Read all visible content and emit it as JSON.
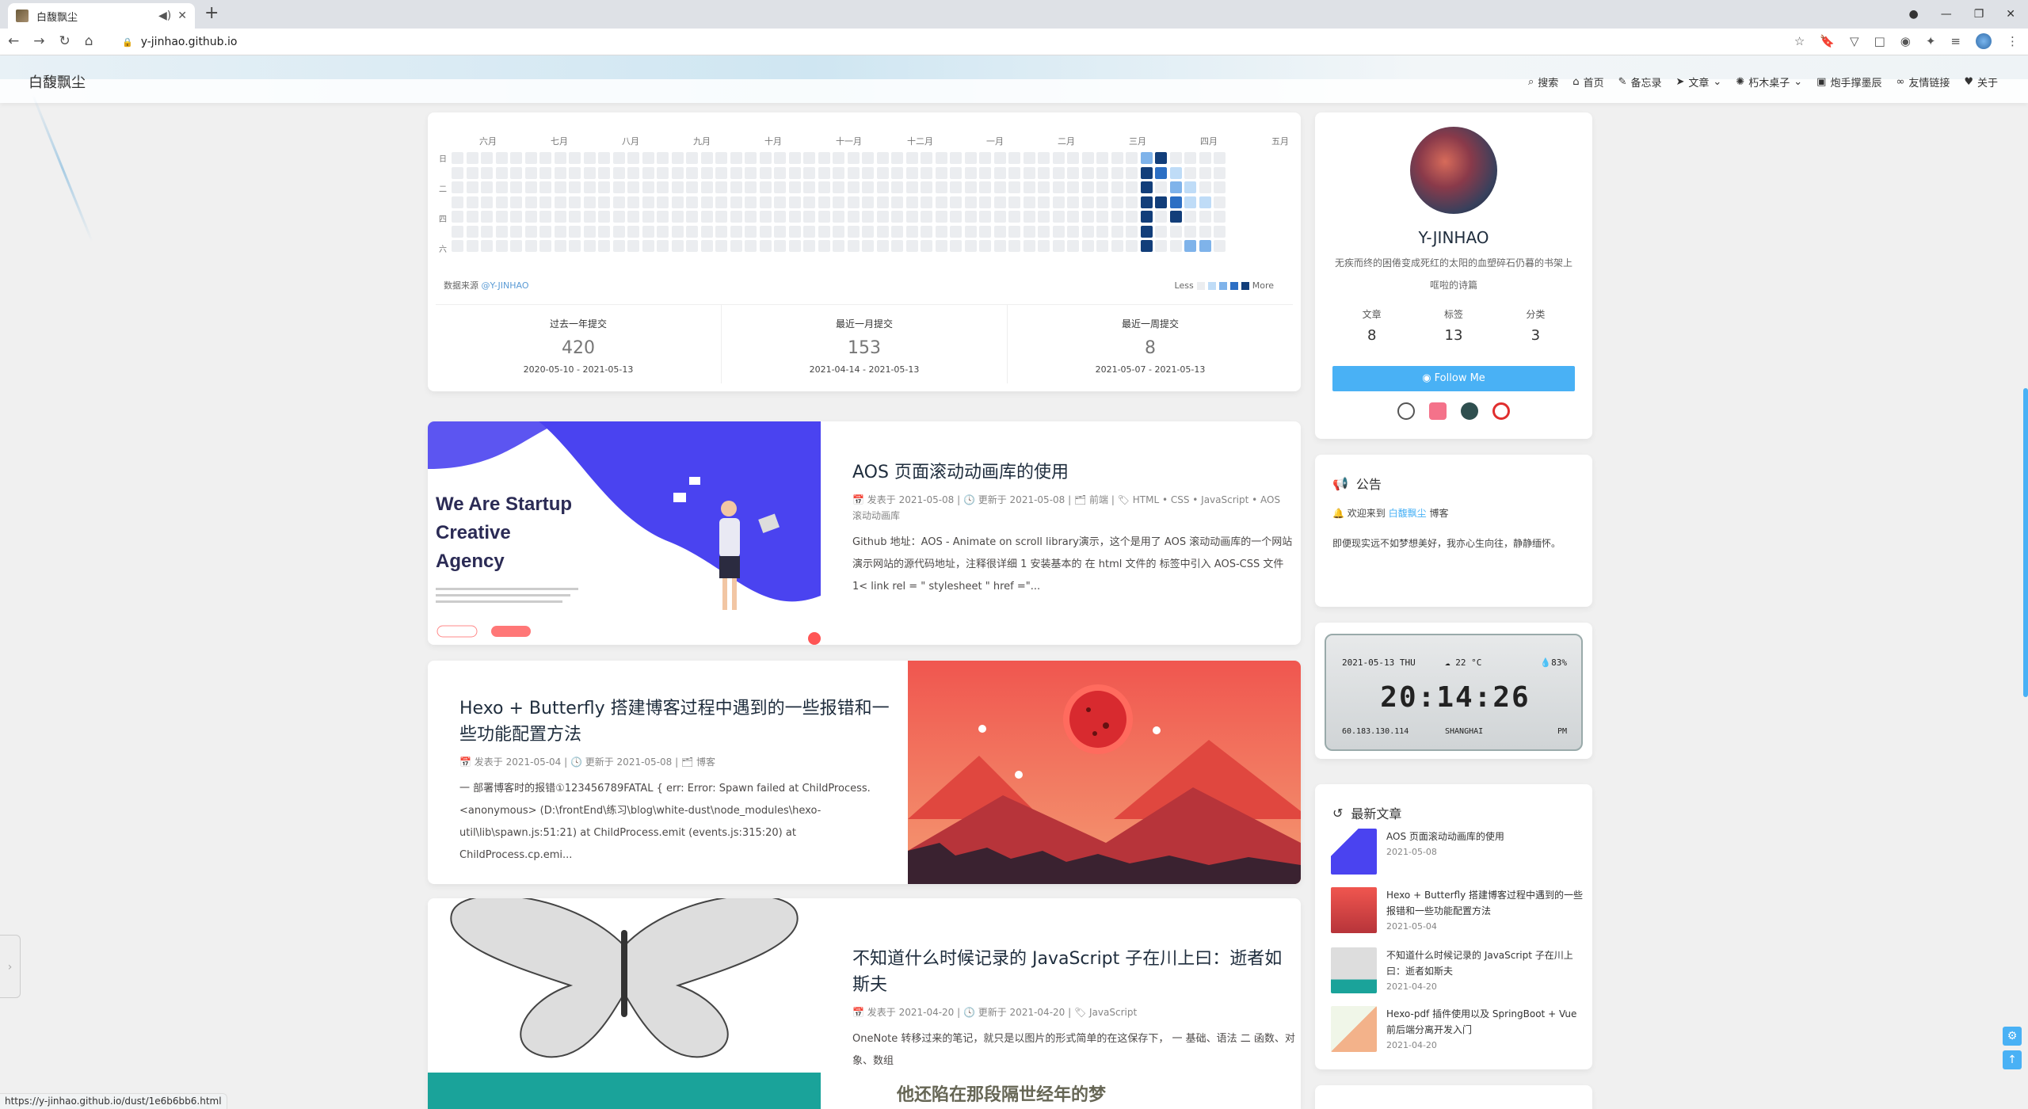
{
  "browser": {
    "tab_title": "白馥飘尘",
    "url": "y-jinhao.github.io",
    "status_url": "https://y-jinhao.github.io/dust/1e6b6bb6.html"
  },
  "site": {
    "brand": "白馥飘尘",
    "menu": [
      {
        "icon": "search-icon",
        "label": "搜索"
      },
      {
        "icon": "home-icon",
        "label": "首页"
      },
      {
        "icon": "edit-icon",
        "label": "备忘录"
      },
      {
        "icon": "paper-plane-icon",
        "label": "文章"
      },
      {
        "icon": "spinner-icon",
        "label": "朽木桌子"
      },
      {
        "icon": "image-icon",
        "label": "炮手撑墨辰"
      },
      {
        "icon": "link-icon",
        "label": "友情链接"
      },
      {
        "icon": "heart-icon",
        "label": "关于"
      }
    ]
  },
  "contributions": {
    "months": [
      "六月",
      "七月",
      "八月",
      "九月",
      "十月",
      "十一月",
      "十二月",
      "一月",
      "二月",
      "三月",
      "四月",
      "五月"
    ],
    "days": [
      "日",
      "二",
      "四",
      "六"
    ],
    "source_label": "数据来源",
    "source_link": "@Y-JINHAO",
    "legend_less": "Less",
    "legend_more": "More",
    "stats": [
      {
        "label": "过去一年提交",
        "value": "420",
        "range": "2020-05-10 - 2021-05-13"
      },
      {
        "label": "最近一月提交",
        "value": "153",
        "range": "2021-04-14 - 2021-05-13"
      },
      {
        "label": "最近一周提交",
        "value": "8",
        "range": "2021-05-07 - 2021-05-13"
      }
    ]
  },
  "posts": [
    {
      "title": "AOS 页面滚动动画库的使用",
      "meta1": "📅 发表于 2021-05-08 | 🕓 更新于 2021-05-08 | 🗂 前端 | 🏷 HTML • CSS • JavaScript • AOS",
      "meta2": "滚动动画库",
      "excerpt": "Github 地址：AOS - Animate on scroll library演示，这个是用了 AOS 滚动动画库的一个网站 演示网站的源代码地址，注释很详细 1 安装基本的 在 html 文件的 标签中引入 AOS-CSS 文件 1< link rel = \" stylesheet \" href =\"...",
      "img_title": "We Are Startup Creative Agency"
    },
    {
      "title": "Hexo + Butterfly 搭建博客过程中遇到的一些报错和一些功能配置方法",
      "meta1": "📅 发表于 2021-05-04 | 🕓 更新于 2021-05-08 | 🗂 博客",
      "excerpt": "一 部署博客时的报错①123456789FATAL { err: Error: Spawn failed at ChildProcess.<anonymous> (D:\\frontEnd\\练习\\blog\\white-dust\\node_modules\\hexo-util\\lib\\spawn.js:51:21) at ChildProcess.emit (events.js:315:20) at ChildProcess.cp.emi..."
    },
    {
      "title": "不知道什么时候记录的 JavaScript 子在川上曰：逝者如斯夫",
      "meta1": "📅 发表于 2021-04-20 | 🕓 更新于 2021-04-20 | 🏷 JavaScript",
      "excerpt": "OneNote 转移过来的笔记，就只是以图片的形式简单的在这保存下， 一 基础、语法 二 函数、对象、数组",
      "overlay": "他还陷在那段隔世经年的梦"
    }
  ],
  "author": {
    "name": "Y-JINHAO",
    "desc": "无疾而终的困倦变成死红的太阳的血塑碎石仍暮的书架上哐啦的诗篇",
    "stats": [
      {
        "label": "文章",
        "value": "8"
      },
      {
        "label": "标签",
        "value": "13"
      },
      {
        "label": "分类",
        "value": "3"
      }
    ],
    "follow": "Follow Me"
  },
  "notice": {
    "title": "公告",
    "line1_pre": "欢迎来到",
    "line1_link": "白馥飘尘",
    "line1_post": "博客",
    "line2": "即便现实远不如梦想美好，我亦心生向往，静静缅怀。"
  },
  "clock": {
    "date": "2021-05-13 THU",
    "weather": "22 °C",
    "humidity": "83%",
    "time": "20:14:26",
    "ip": "60.183.130.114",
    "city": "SHANGHAI",
    "ampm": "PM"
  },
  "recent": {
    "title": "最新文章",
    "items": [
      {
        "title": "AOS 页面滚动动画库的使用",
        "date": "2021-05-08"
      },
      {
        "title": "Hexo + Butterfly 搭建博客过程中遇到的一些报错和一些功能配置方法",
        "date": "2021-05-04"
      },
      {
        "title": "不知道什么时候记录的 JavaScript 子在川上曰：逝者如斯夫",
        "date": "2021-04-20"
      },
      {
        "title": "Hexo-pdf 插件使用以及 SpringBoot + Vue 前后端分离开发入门",
        "date": "2021-04-20"
      }
    ]
  }
}
